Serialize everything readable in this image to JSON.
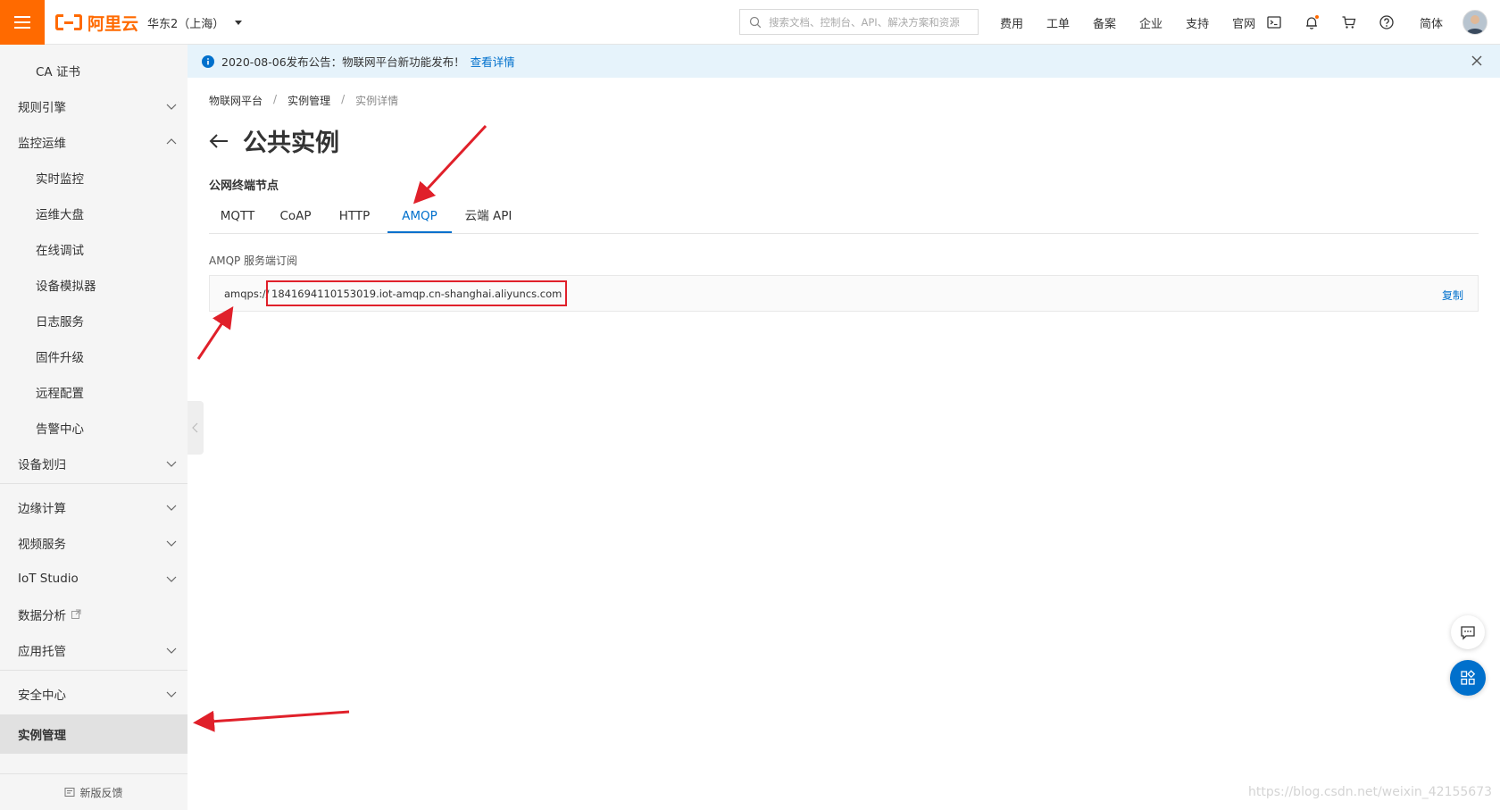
{
  "topbar": {
    "logo_text": "阿里云",
    "region": "华东2（上海）",
    "search_placeholder": "搜索文档、控制台、API、解决方案和资源",
    "links": [
      "费用",
      "工单",
      "备案",
      "企业",
      "支持",
      "官网"
    ],
    "lang": "简体",
    "icons": [
      "terminal-icon",
      "bell-icon",
      "cart-icon",
      "help-icon"
    ],
    "notification_dot_color": "#ff6a00"
  },
  "sidebar": {
    "items": [
      {
        "label": "CA 证书",
        "level": "sub"
      },
      {
        "label": "规则引擎",
        "level": "top",
        "chevron": "down"
      },
      {
        "label": "监控运维",
        "level": "top",
        "chevron": "up"
      },
      {
        "label": "实时监控",
        "level": "sub"
      },
      {
        "label": "运维大盘",
        "level": "sub"
      },
      {
        "label": "在线调试",
        "level": "sub"
      },
      {
        "label": "设备模拟器",
        "level": "sub"
      },
      {
        "label": "日志服务",
        "level": "sub"
      },
      {
        "label": "固件升级",
        "level": "sub"
      },
      {
        "label": "远程配置",
        "level": "sub"
      },
      {
        "label": "告警中心",
        "level": "sub"
      },
      {
        "label": "设备划归",
        "level": "top",
        "chevron": "down"
      },
      {
        "label": "边缘计算",
        "level": "top",
        "chevron": "down"
      },
      {
        "label": "视频服务",
        "level": "top",
        "chevron": "down"
      },
      {
        "label": "IoT Studio",
        "level": "top",
        "chevron": "down"
      },
      {
        "label": "数据分析",
        "level": "top",
        "external": true
      },
      {
        "label": "应用托管",
        "level": "top",
        "chevron": "down"
      },
      {
        "label": "安全中心",
        "level": "top",
        "chevron": "down"
      },
      {
        "label": "实例管理",
        "level": "top",
        "active": true
      }
    ],
    "feedback": "新版反馈"
  },
  "notice": {
    "text": "2020-08-06发布公告：物联网平台新功能发布！",
    "link": "查看详情"
  },
  "breadcrumb": [
    "物联网平台",
    "实例管理",
    "实例详情"
  ],
  "page_title": "公共实例",
  "section_label": "公网终端节点",
  "tabs": [
    {
      "label": "MQTT",
      "active": false
    },
    {
      "label": "CoAP",
      "active": false
    },
    {
      "label": "HTTP",
      "active": false
    },
    {
      "label": "AMQP",
      "active": true
    },
    {
      "label": "云端 API",
      "active": false
    }
  ],
  "endpoint": {
    "label": "AMQP 服务端订阅",
    "prefix": "amqps://",
    "host": "1841694110153019.iot-amqp.cn-shanghai.aliyuncs.com",
    "copy_label": "复制"
  },
  "watermark": "https://blog.csdn.net/weixin_42155673",
  "colors": {
    "brand": "#ff6a00",
    "accent": "#0070cc",
    "annotation": "#e0202a"
  }
}
